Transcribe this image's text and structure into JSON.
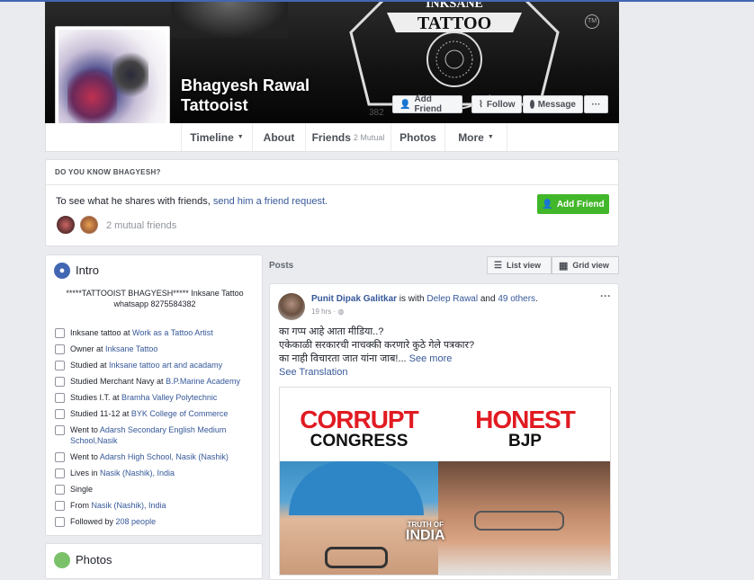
{
  "profile": {
    "name_line1": "Bhagyesh Rawal",
    "name_line2": "Tattooist"
  },
  "cover": {
    "brand_top": "INKSANE",
    "brand": "TATTOO",
    "tm": "TM",
    "partial_text": "382"
  },
  "cover_buttons": {
    "add_friend": "Add Friend",
    "follow": "Follow",
    "message": "Message",
    "more": "···"
  },
  "tabs": [
    {
      "label": "Timeline"
    },
    {
      "label": "About"
    },
    {
      "label": "Friends",
      "extra": "2 Mutual"
    },
    {
      "label": "Photos"
    },
    {
      "label": "More"
    }
  ],
  "dyk": {
    "heading": "DO YOU KNOW BHAGYESH?",
    "text_before": "To see what he shares with friends, ",
    "link": "send him a friend request.",
    "button": "Add Friend",
    "mutual": "2 mutual friends"
  },
  "intro": {
    "title": "Intro",
    "bio": "*****TATTOOIST BHAGYESH***** Inksane Tattoo whatsapp 8275584382",
    "items": [
      {
        "pre": "Inksane tattoo at ",
        "link": "Work as a Tattoo Artist",
        "post": ""
      },
      {
        "pre": "Owner at ",
        "link": "Inksane Tattoo",
        "post": ""
      },
      {
        "pre": "Studied at ",
        "link": "Inksane tattoo art and acadamy",
        "post": ""
      },
      {
        "pre": "Studied Merchant Navy at ",
        "link": "B.P.Marine Academy",
        "post": ""
      },
      {
        "pre": "Studies I.T. at ",
        "link": "Bramha Valley Polytechnic",
        "post": ""
      },
      {
        "pre": "Studied 11-12 at ",
        "link": "BYK College of Commerce",
        "post": ""
      },
      {
        "pre": "Went to ",
        "link": "Adarsh Secondary English Medium School,Nasik",
        "post": ""
      },
      {
        "pre": "Went to ",
        "link": "Adarsh High School, Nasik (Nashik)",
        "post": ""
      },
      {
        "pre": "Lives in ",
        "link": "Nasik (Nashik), India",
        "post": ""
      },
      {
        "pre": "Single",
        "link": "",
        "post": ""
      },
      {
        "pre": "From ",
        "link": "Nasik (Nashik), India",
        "post": ""
      },
      {
        "pre": "Followed by ",
        "link": "208 people",
        "post": ""
      }
    ]
  },
  "photos": {
    "title": "Photos"
  },
  "posts": {
    "label": "Posts",
    "list_view": "List view",
    "grid_view": "Grid view"
  },
  "post": {
    "author": "Punit Dipak Galitkar",
    "is_with": " is with ",
    "tag1": "Delep Rawal",
    "and": " and ",
    "tag2": "49 others",
    "period": ".",
    "time": "19 hrs · ",
    "line1": "का गप्प आहे आता मीडिया..?",
    "line2": "एकेकाळी सरकारची नाचक्की करणारे कुठे गेले पत्रकार?",
    "line3": "का नाही विचारता जात यांना जाब!...",
    "see_more": " See more",
    "translation": "See Translation",
    "menu": "···",
    "image": {
      "left_top": "CORRUPT",
      "left_bottom": "CONGRESS",
      "right_top": "HONEST",
      "right_bottom": "BJP",
      "watermark_top": "TRUTH OF",
      "watermark_bottom": "INDIA"
    }
  },
  "colors": {
    "fb_blue": "#4267b2",
    "link": "#365899",
    "green": "#42b72a",
    "red": "#e11b22"
  }
}
